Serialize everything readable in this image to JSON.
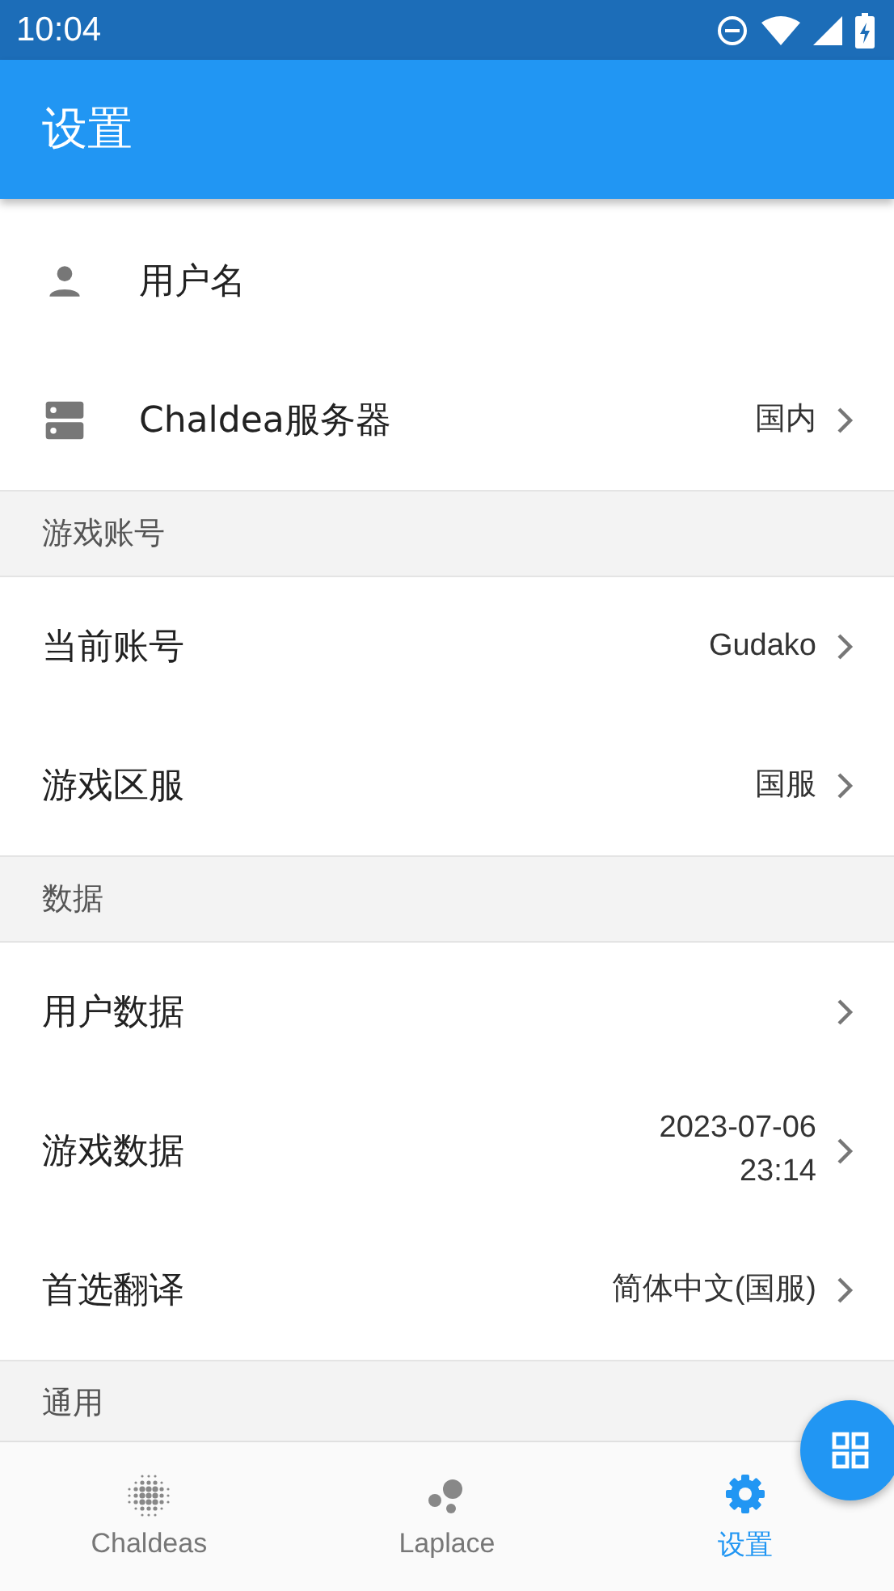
{
  "status_bar": {
    "time": "10:04"
  },
  "app_bar": {
    "title": "设置"
  },
  "sections": [
    {
      "items": [
        {
          "label": "用户名",
          "chevron": false
        },
        {
          "label": "Chaldea服务器",
          "value": "国内",
          "chevron": true
        }
      ]
    },
    {
      "header": "游戏账号",
      "items": [
        {
          "label": "当前账号",
          "value": "Gudako",
          "chevron": true
        },
        {
          "label": "游戏区服",
          "value": "国服",
          "chevron": true
        }
      ]
    },
    {
      "header": "数据",
      "items": [
        {
          "label": "用户数据",
          "chevron": true
        },
        {
          "label": "游戏数据",
          "value": "2023-07-06\n23:14",
          "chevron": true
        },
        {
          "label": "首选翻译",
          "value": "简体中文(国服)",
          "chevron": true
        }
      ]
    },
    {
      "header": "通用"
    }
  ],
  "bottom_nav": [
    {
      "label": "Chaldeas",
      "selected": false
    },
    {
      "label": "Laplace",
      "selected": false
    },
    {
      "label": "设置",
      "selected": true
    }
  ]
}
